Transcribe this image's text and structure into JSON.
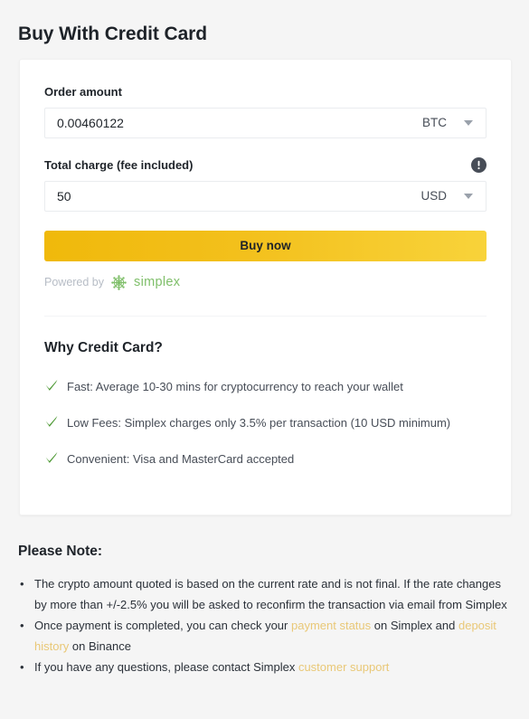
{
  "page": {
    "title": "Buy With Credit Card",
    "background_color": "#f5f5f5",
    "accent_color": "#f0b90b",
    "link_color": "#e9c877"
  },
  "form": {
    "order_amount": {
      "label": "Order amount",
      "value": "0.00460122",
      "placeholder": "0.00460122",
      "currency": "BTC",
      "caret_icon": "chevron-down-icon"
    },
    "total_charge": {
      "label": "Total charge (fee included)",
      "info_icon": "info-icon",
      "value": "50",
      "placeholder": "50",
      "currency": "USD",
      "caret_icon": "chevron-down-icon"
    },
    "buy_button": "Buy now",
    "powered_by": {
      "prefix": "Powered by",
      "logo_icon": "simplex-logo-icon",
      "brand": "simplex"
    }
  },
  "why": {
    "title": "Why Credit Card?",
    "benefits": [
      {
        "icon": "check-icon",
        "text": "Fast: Average 10-30 mins for cryptocurrency to reach your wallet"
      },
      {
        "icon": "check-icon",
        "text": "Low Fees: Simplex charges only 3.5% per transaction (10 USD minimum)"
      },
      {
        "icon": "check-icon",
        "text": "Convenient: Visa and MasterCard accepted"
      }
    ]
  },
  "notes": {
    "title": "Please Note:",
    "items": [
      {
        "parts": [
          {
            "text": "The crypto amount quoted is based on the current rate and is not final. If the rate changes by more than +/-2.5% you will be asked to reconfirm the transaction via email from Simplex",
            "link": false
          }
        ]
      },
      {
        "parts": [
          {
            "text": "Once payment is completed, you can check your ",
            "link": false
          },
          {
            "text": "payment status",
            "link": true
          },
          {
            "text": "  on Simplex and  ",
            "link": false
          },
          {
            "text": "deposit history",
            "link": true
          },
          {
            "text": " on Binance",
            "link": false
          }
        ]
      },
      {
        "parts": [
          {
            "text": "If you have any questions, please contact Simplex ",
            "link": false
          },
          {
            "text": "customer support",
            "link": true
          }
        ]
      }
    ]
  }
}
